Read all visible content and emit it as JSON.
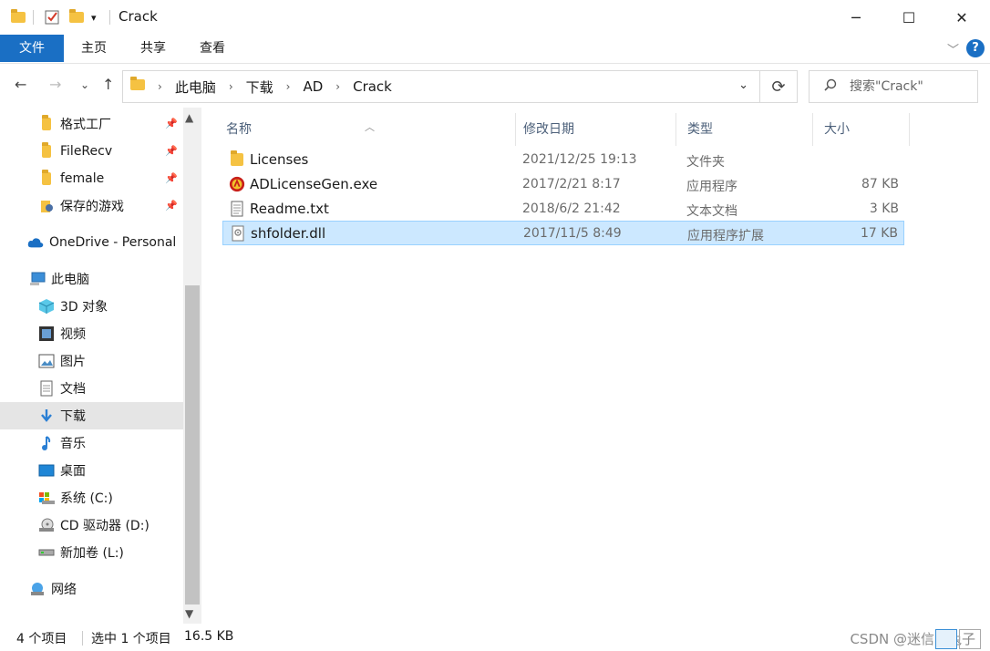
{
  "window": {
    "title": "Crack",
    "minimize": "─",
    "maximize": "☐",
    "close": "✕"
  },
  "ribbon": {
    "tabs": [
      "文件",
      "主页",
      "共享",
      "查看"
    ],
    "help": "?"
  },
  "address": {
    "crumbs": [
      "此电脑",
      "下载",
      "AD",
      "Crack"
    ],
    "search_placeholder": "搜索\"Crack\""
  },
  "sidebar": {
    "quick_access": [
      {
        "label": "格式工厂",
        "icon": "folder-icon",
        "pinned": true
      },
      {
        "label": "FileRecv",
        "icon": "folder-icon",
        "pinned": true
      },
      {
        "label": "female",
        "icon": "folder-icon",
        "pinned": true
      },
      {
        "label": "保存的游戏",
        "icon": "saved-games-icon",
        "pinned": true
      }
    ],
    "onedrive": "OneDrive - Personal",
    "this_pc": "此电脑",
    "pc_items": [
      {
        "label": "3D 对象",
        "icon": "3d-objects-icon"
      },
      {
        "label": "视频",
        "icon": "video-icon"
      },
      {
        "label": "图片",
        "icon": "pictures-icon"
      },
      {
        "label": "文档",
        "icon": "documents-icon"
      },
      {
        "label": "下载",
        "icon": "downloads-icon",
        "selected": true
      },
      {
        "label": "音乐",
        "icon": "music-icon"
      },
      {
        "label": "桌面",
        "icon": "desktop-icon"
      },
      {
        "label": "系统 (C:)",
        "icon": "system-drive-icon"
      },
      {
        "label": "CD 驱动器 (D:)",
        "icon": "cd-drive-icon"
      },
      {
        "label": "新加卷 (L:)",
        "icon": "drive-icon"
      }
    ],
    "network": "网络"
  },
  "columns": {
    "name": "名称",
    "date": "修改日期",
    "type": "类型",
    "size": "大小"
  },
  "files": [
    {
      "name": "Licenses",
      "date": "2021/12/25 19:13",
      "type": "文件夹",
      "size": "",
      "icon": "folder-icon"
    },
    {
      "name": "ADLicenseGen.exe",
      "date": "2017/2/21 8:17",
      "type": "应用程序",
      "size": "87 KB",
      "icon": "exe-icon"
    },
    {
      "name": "Readme.txt",
      "date": "2018/6/2 21:42",
      "type": "文本文档",
      "size": "3 KB",
      "icon": "text-file-icon"
    },
    {
      "name": "shfolder.dll",
      "date": "2017/11/5 8:49",
      "type": "应用程序扩展",
      "size": "17 KB",
      "icon": "dll-icon",
      "selected": true
    }
  ],
  "status": {
    "item_count": "4 个项目",
    "selected": "选中 1 个项目",
    "size": "16.5 KB",
    "watermark": "CSDN @迷信的兔子"
  },
  "colors": {
    "accent": "#1a6fc4",
    "selection": "#cce8ff",
    "selection_border": "#99d1ff"
  }
}
